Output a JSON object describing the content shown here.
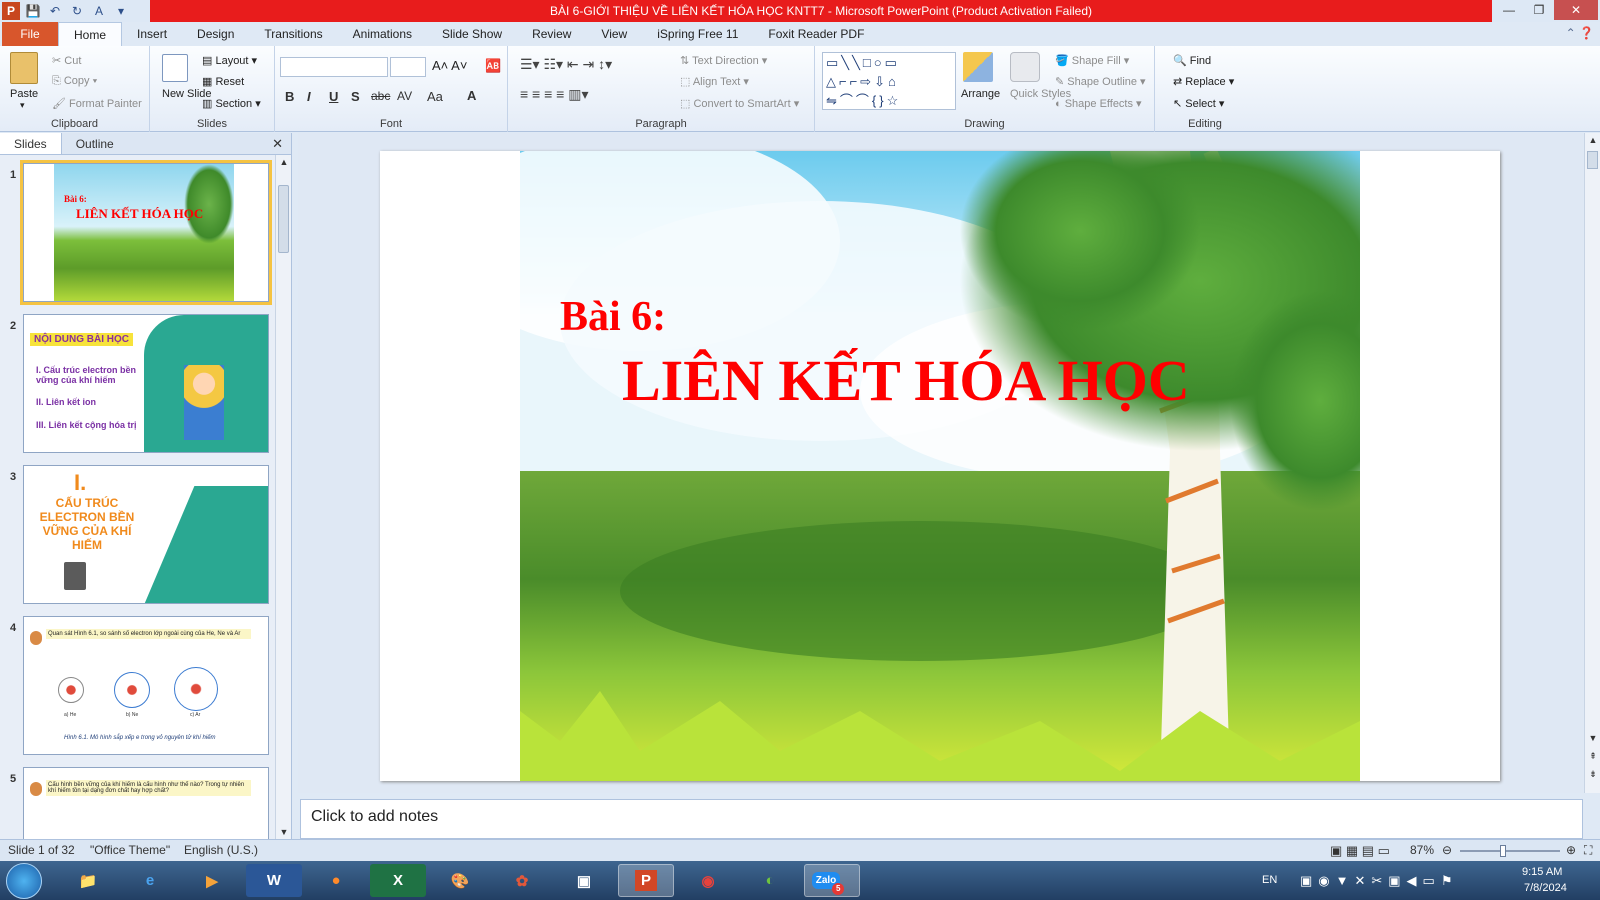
{
  "window": {
    "title": "BÀI 6-GIỚI THIỆU VỀ LIÊN KẾT HÓA HỌC KNTT7  -  Microsoft PowerPoint (Product Activation Failed)",
    "app_icon": "P",
    "minimize": "—",
    "maximize": "❐",
    "close": "✕"
  },
  "tabs": [
    "File",
    "Home",
    "Insert",
    "Design",
    "Transitions",
    "Animations",
    "Slide Show",
    "Review",
    "View",
    "iSpring Free 11",
    "Foxit Reader PDF"
  ],
  "active_tab": "Home",
  "ribbon": {
    "clipboard": {
      "label": "Clipboard",
      "paste": "Paste",
      "cut": "Cut",
      "copy": "Copy",
      "format_painter": "Format Painter"
    },
    "slides": {
      "label": "Slides",
      "new_slide": "New Slide",
      "layout": "Layout",
      "reset": "Reset",
      "section": "Section"
    },
    "font": {
      "label": "Font",
      "font_name": "",
      "font_size": "",
      "bold": "B",
      "italic": "I",
      "underline": "U",
      "shadow": "S",
      "strike": "abc",
      "spacing": "AV",
      "case": "Aa",
      "color": "A"
    },
    "paragraph": {
      "label": "Paragraph",
      "text_direction": "Text Direction",
      "align_text": "Align Text",
      "convert_smartart": "Convert to SmartArt"
    },
    "drawing": {
      "label": "Drawing",
      "arrange": "Arrange",
      "quick_styles": "Quick Styles",
      "shape_fill": "Shape Fill",
      "shape_outline": "Shape Outline",
      "shape_effects": "Shape Effects"
    },
    "editing": {
      "label": "Editing",
      "find": "Find",
      "replace": "Replace",
      "select": "Select"
    }
  },
  "pane": {
    "tabs": [
      "Slides",
      "Outline"
    ],
    "close": "✕"
  },
  "thumbnails": [
    {
      "num": "1",
      "line1": "Bài 6:",
      "line2": "LIÊN KẾT HÓA HỌC"
    },
    {
      "num": "2",
      "title": "NỘI DUNG BÀI HỌC",
      "items": [
        "I. Cấu trúc electron bền vững của khí hiếm",
        "II. Liên kết ion",
        "III. Liên kết cộng hóa trị"
      ]
    },
    {
      "num": "3",
      "roman": "I.",
      "title": "CẤU TRÚC ELECTRON BỀN VỮNG CỦA KHÍ HIẾM"
    },
    {
      "num": "4",
      "question": "Quan sát Hình 6.1, so sánh số electron lớp ngoài cùng của He, Ne và Ar",
      "atoms": [
        "a) He",
        "b) Ne",
        "c) Ar"
      ],
      "caption": "Hình 6.1. Mô hình sắp xếp e trong vỏ nguyên tử khí hiếm"
    },
    {
      "num": "5",
      "question": "Cấu hình bền vững của khí hiếm là cấu hình như thế nào? Trong tự nhiên khí hiếm tồn tại dạng đơn chất hay hợp chất?"
    }
  ],
  "slide": {
    "line1": "Bài 6:",
    "line2": "LIÊN KẾT HÓA HỌC"
  },
  "notes": "Click to add notes",
  "status": {
    "slide": "Slide 1 of 32",
    "theme": "\"Office Theme\"",
    "lang": "English (U.S.)",
    "zoom": "87%",
    "zoom_level": 0.87
  },
  "taskbar": {
    "lang": "EN",
    "time": "9:15 AM",
    "date": "7/8/2024",
    "zalo_badge": "5"
  },
  "colors": {
    "title_red": "#ff0000",
    "file_tab": "#d8562c",
    "titlebar_red": "#e81c1c"
  }
}
